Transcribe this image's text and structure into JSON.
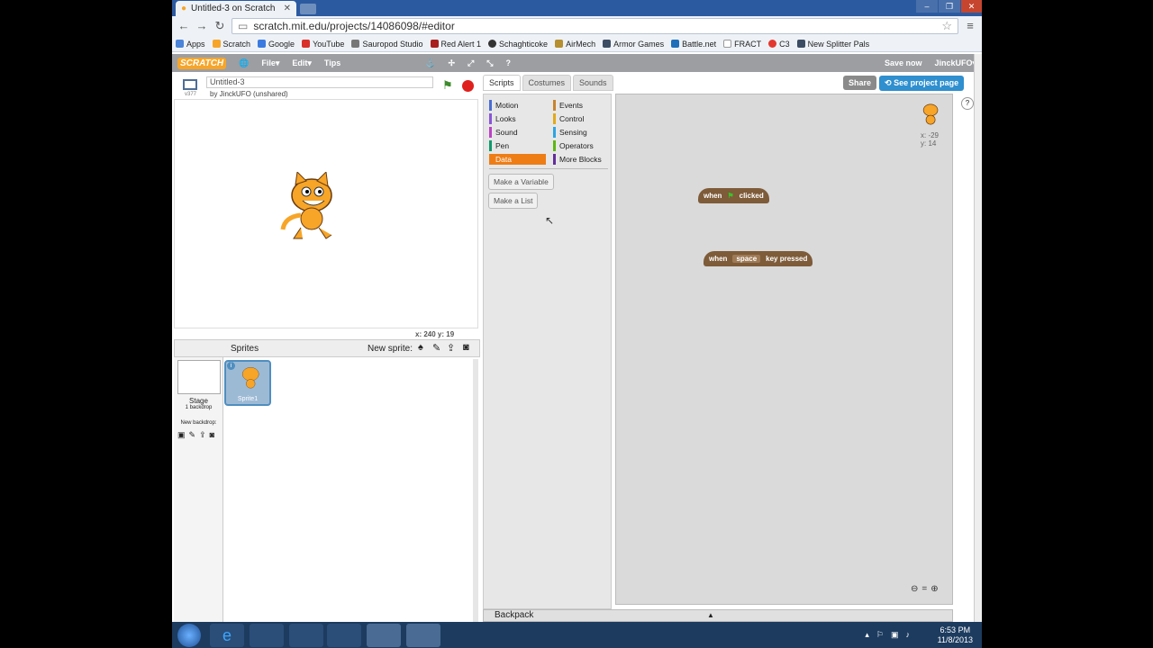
{
  "browser": {
    "tab_title": "Untitled-3 on Scratch",
    "url": "scratch.mit.edu/projects/14086098/#editor",
    "bookmarks": [
      "Apps",
      "Scratch",
      "Google",
      "YouTube",
      "Sauropod Studio",
      "Red Alert 1",
      "Schaghticoke",
      "AirMech",
      "Armor Games",
      "Battle.net",
      "FRACT",
      "C3",
      "New Splitter Pals"
    ]
  },
  "menu": {
    "logo": "SCRATCH",
    "file": "File▾",
    "edit": "Edit▾",
    "tips": "Tips",
    "save_now": "Save now",
    "user": "JinckUFO▾"
  },
  "project": {
    "title": "Untitled-3",
    "version": "v377",
    "byline": "by JinckUFO (unshared)",
    "share": "Share",
    "see_project": "See project page"
  },
  "stage": {
    "coords": "x: 240   y: 19"
  },
  "sprites": {
    "header": "Sprites",
    "new_sprite": "New sprite:",
    "stage_label": "Stage",
    "stage_sub": "1 backdrop",
    "new_backdrop": "New backdrop:",
    "sprite_name": "Sprite1"
  },
  "tabs": [
    "Scripts",
    "Costumes",
    "Sounds"
  ],
  "categories": [
    {
      "label": "Motion",
      "color": "#4a6cd4"
    },
    {
      "label": "Events",
      "color": "#c88330"
    },
    {
      "label": "Looks",
      "color": "#8a55d7"
    },
    {
      "label": "Control",
      "color": "#e1a91a"
    },
    {
      "label": "Sound",
      "color": "#bb42c3"
    },
    {
      "label": "Sensing",
      "color": "#2ca5e2"
    },
    {
      "label": "Pen",
      "color": "#0e9a6c"
    },
    {
      "label": "Operators",
      "color": "#5cb712"
    },
    {
      "label": "Data",
      "color": "#ee7d16"
    },
    {
      "label": "More Blocks",
      "color": "#632d99"
    }
  ],
  "palette_buttons": [
    "Make a Variable",
    "Make a List"
  ],
  "scripts": {
    "block1": {
      "when": "when",
      "clicked": "clicked"
    },
    "block2": {
      "when": "when",
      "key": "space",
      "pressed": "key pressed"
    },
    "sprite_x": "x: -29",
    "sprite_y": "y: 14"
  },
  "backpack": "Backpack",
  "taskbar": {
    "time": "6:53 PM",
    "date": "11/8/2013"
  }
}
